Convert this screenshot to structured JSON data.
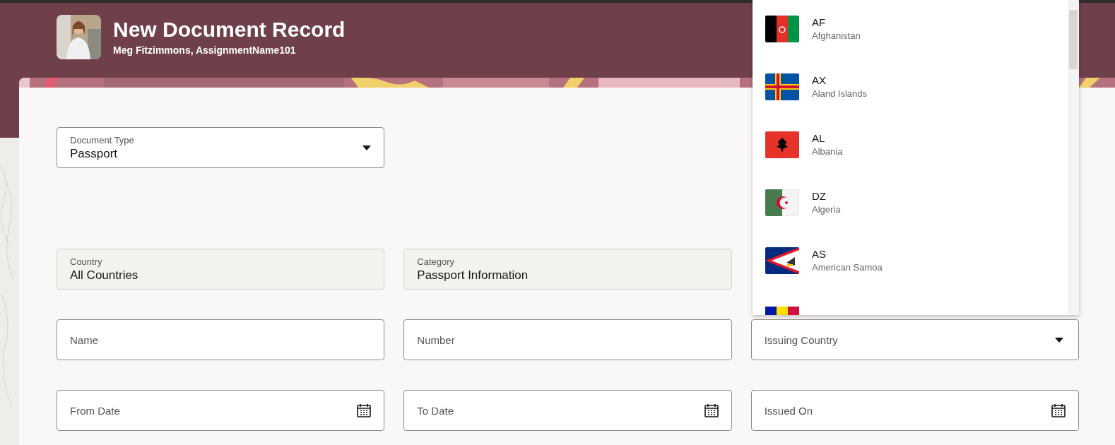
{
  "header": {
    "title": "New Document Record",
    "subtitle": "Meg Fitzimmons, AssignmentName101"
  },
  "document_type": {
    "label": "Document Type",
    "value": "Passport"
  },
  "country": {
    "label": "Country",
    "value": "All Countries"
  },
  "category": {
    "label": "Category",
    "value": "Passport Information"
  },
  "fields": [
    {
      "kind": "text",
      "placeholder": "Name"
    },
    {
      "kind": "text",
      "placeholder": "Number"
    },
    {
      "kind": "select",
      "placeholder": "Issuing Country"
    },
    {
      "kind": "date",
      "placeholder": "From Date"
    },
    {
      "kind": "date",
      "placeholder": "To Date"
    },
    {
      "kind": "date",
      "placeholder": "Issued On"
    }
  ],
  "country_dropdown": {
    "options": [
      {
        "code": "AF",
        "name": "Afghanistan"
      },
      {
        "code": "AX",
        "name": "Aland Islands"
      },
      {
        "code": "AL",
        "name": "Albania"
      },
      {
        "code": "DZ",
        "name": "Algeria"
      },
      {
        "code": "AS",
        "name": "American Samoa"
      }
    ]
  }
}
